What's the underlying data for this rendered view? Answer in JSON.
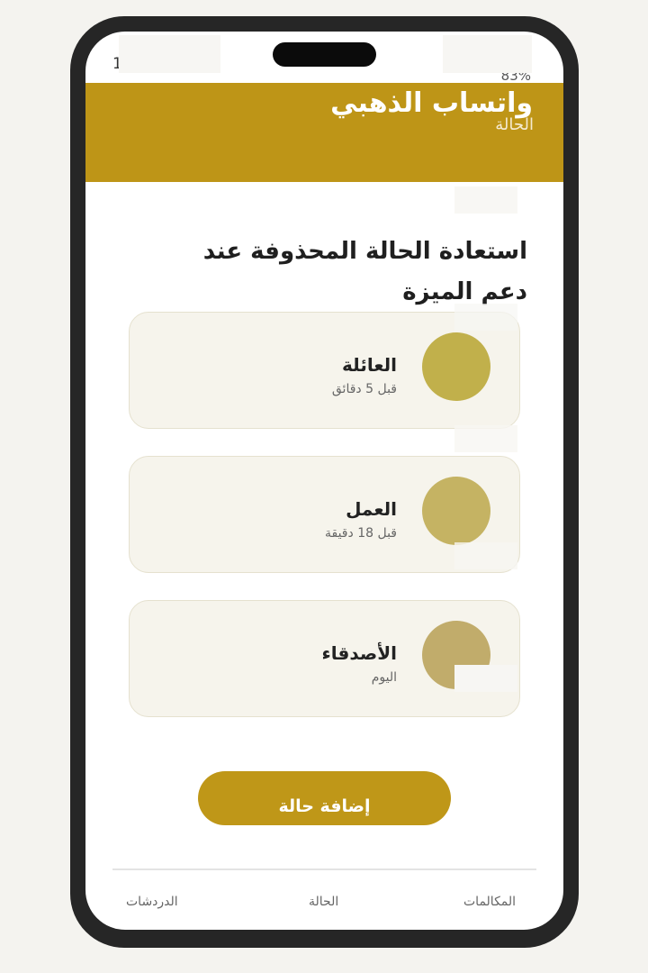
{
  "status_bar": {
    "time_fragment": "1",
    "battery": "83%"
  },
  "header": {
    "title": "واتساب الذهبي",
    "tab": "الحالة"
  },
  "promo": {
    "text": "استعادة الحالة المحذوفة عند دعم الميزة"
  },
  "statuses": [
    {
      "name": "العائلة",
      "time": "قبل 5 دقائق",
      "avatar_color": "#c1b04b"
    },
    {
      "name": "العمل",
      "time": "قبل 18 دقيقة",
      "avatar_color": "#c5b363"
    },
    {
      "name": "الأصدقاء",
      "time": "اليوم",
      "avatar_color": "#c1ac6b"
    }
  ],
  "actions": {
    "add_status": "إضافة حالة"
  },
  "bottom_nav": {
    "chats": "الدردشات",
    "status": "الحالة",
    "calls": "المكالمات"
  },
  "colors": {
    "accent": "#be9517",
    "frame": "#262626",
    "card_bg": "#f6f4ec"
  }
}
